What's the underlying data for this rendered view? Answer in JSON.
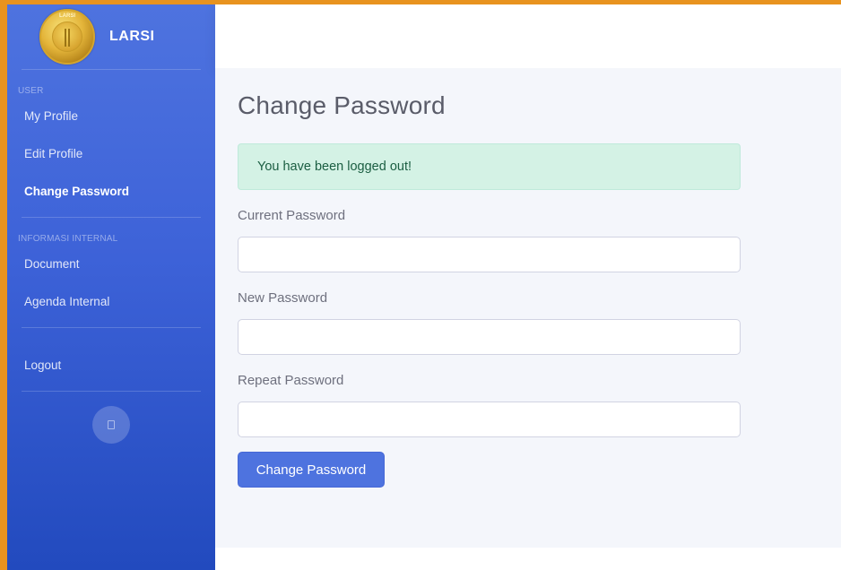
{
  "brand": {
    "name": "LARSI",
    "logo_text": "LARSI"
  },
  "sidebar": {
    "sections": [
      {
        "heading": "USER",
        "items": [
          {
            "label": "My Profile",
            "active": false
          },
          {
            "label": "Edit Profile",
            "active": false
          },
          {
            "label": "Change Password",
            "active": true
          }
        ]
      },
      {
        "heading": "INFORMASI INTERNAL",
        "items": [
          {
            "label": "Document",
            "active": false
          },
          {
            "label": "Agenda Internal",
            "active": false
          }
        ]
      }
    ],
    "logout_label": "Logout",
    "toggle_icon": "sidebar-toggle-icon"
  },
  "main": {
    "title": "Change Password",
    "alert": "You have been logged out!",
    "fields": {
      "current": {
        "label": "Current Password",
        "value": ""
      },
      "new": {
        "label": "New Password",
        "value": ""
      },
      "repeat": {
        "label": "Repeat Password",
        "value": ""
      }
    },
    "submit_label": "Change Password"
  },
  "colors": {
    "frame": "#e8931f",
    "sidebar_primary": "#4e73df",
    "alert_bg": "#d4f2e5",
    "button": "#4e73df"
  }
}
